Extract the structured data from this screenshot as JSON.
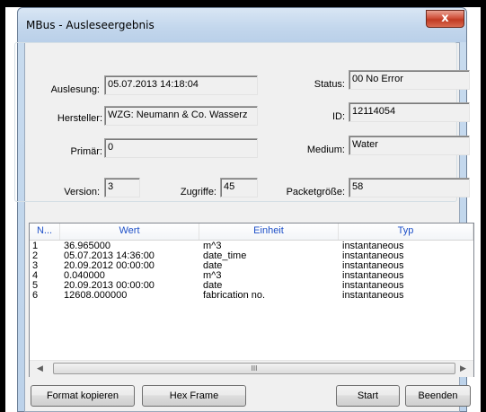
{
  "window": {
    "title": "MBus - Ausleseergebnis",
    "close_glyph": "x"
  },
  "fields": {
    "auslesung": {
      "label": "Auslesung:",
      "value": "05.07.2013 14:18:04"
    },
    "hersteller": {
      "label": "Hersteller:",
      "value": "WZG: Neumann & Co. Wasserz"
    },
    "primaer": {
      "label": "Primär:",
      "value": "0"
    },
    "version": {
      "label": "Version:",
      "value": "3"
    },
    "zugriffe": {
      "label": "Zugriffe:",
      "value": "45"
    },
    "packetgroesse": {
      "label": "Packetgröße:",
      "value": "58"
    },
    "status": {
      "label": "Status:",
      "value": "00 No Error"
    },
    "id": {
      "label": "ID:",
      "value": "12114054"
    },
    "medium": {
      "label": "Medium:",
      "value": "Water"
    }
  },
  "table": {
    "columns": [
      "N...",
      "Wert",
      "Einheit",
      "Typ"
    ],
    "rows": [
      {
        "n": "1",
        "wert": "36.965000",
        "einheit": "m^3",
        "typ": "instantaneous"
      },
      {
        "n": "2",
        "wert": "05.07.2013 14:36:00",
        "einheit": "date_time",
        "typ": "instantaneous"
      },
      {
        "n": "3",
        "wert": "20.09.2012 00:00:00",
        "einheit": "date",
        "typ": "instantaneous"
      },
      {
        "n": "4",
        "wert": "0.040000",
        "einheit": "m^3",
        "typ": "instantaneous"
      },
      {
        "n": "5",
        "wert": "20.09.2013 00:00:00",
        "einheit": "date",
        "typ": "instantaneous"
      },
      {
        "n": "6",
        "wert": "12608.000000",
        "einheit": "fabrication no.",
        "typ": "instantaneous"
      }
    ],
    "scroll_thumb_grip": "III"
  },
  "buttons": {
    "format_kopieren": "Format kopieren",
    "hex_frame": "Hex Frame",
    "start": "Start",
    "beenden": "Beenden"
  },
  "colors": {
    "header_text": "#1e50c8",
    "close_button": "#c03a22"
  }
}
